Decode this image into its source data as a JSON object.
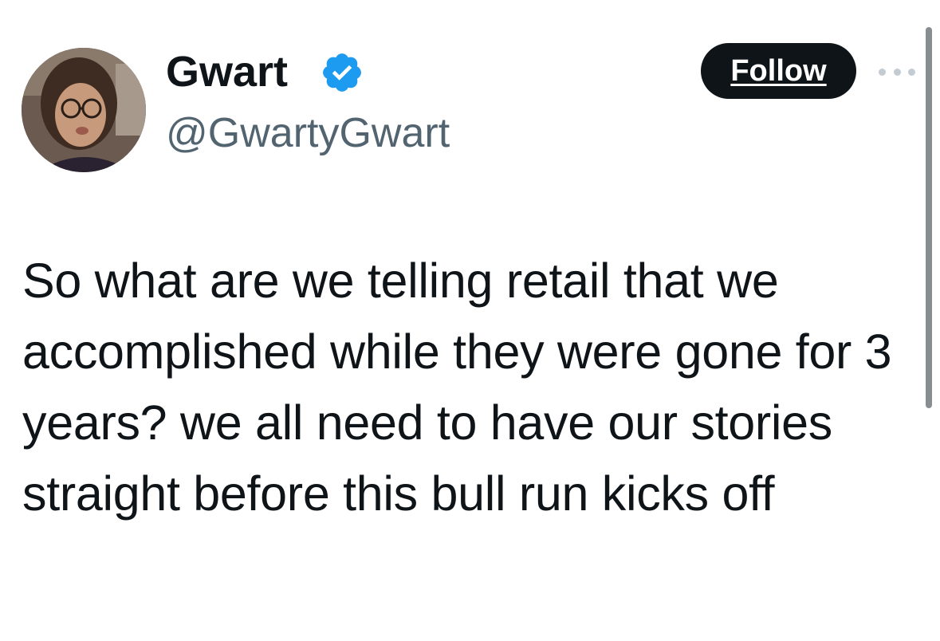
{
  "author": {
    "display_name": "Gwart",
    "handle": "@GwartyGwart",
    "verified_icon": "verified-badge-icon",
    "avatar_icon": "user-avatar"
  },
  "actions": {
    "follow_label": "Follow",
    "more_icon": "more-options-icon"
  },
  "tweet": {
    "text": "So what are we telling retail that we accomplished while they were gone for 3 years? we all need to have our stories straight before this bull run kicks off"
  },
  "colors": {
    "text_primary": "#0f1419",
    "text_secondary": "#536471",
    "verified_blue": "#1d9bf0",
    "follow_bg": "#0f1419"
  }
}
